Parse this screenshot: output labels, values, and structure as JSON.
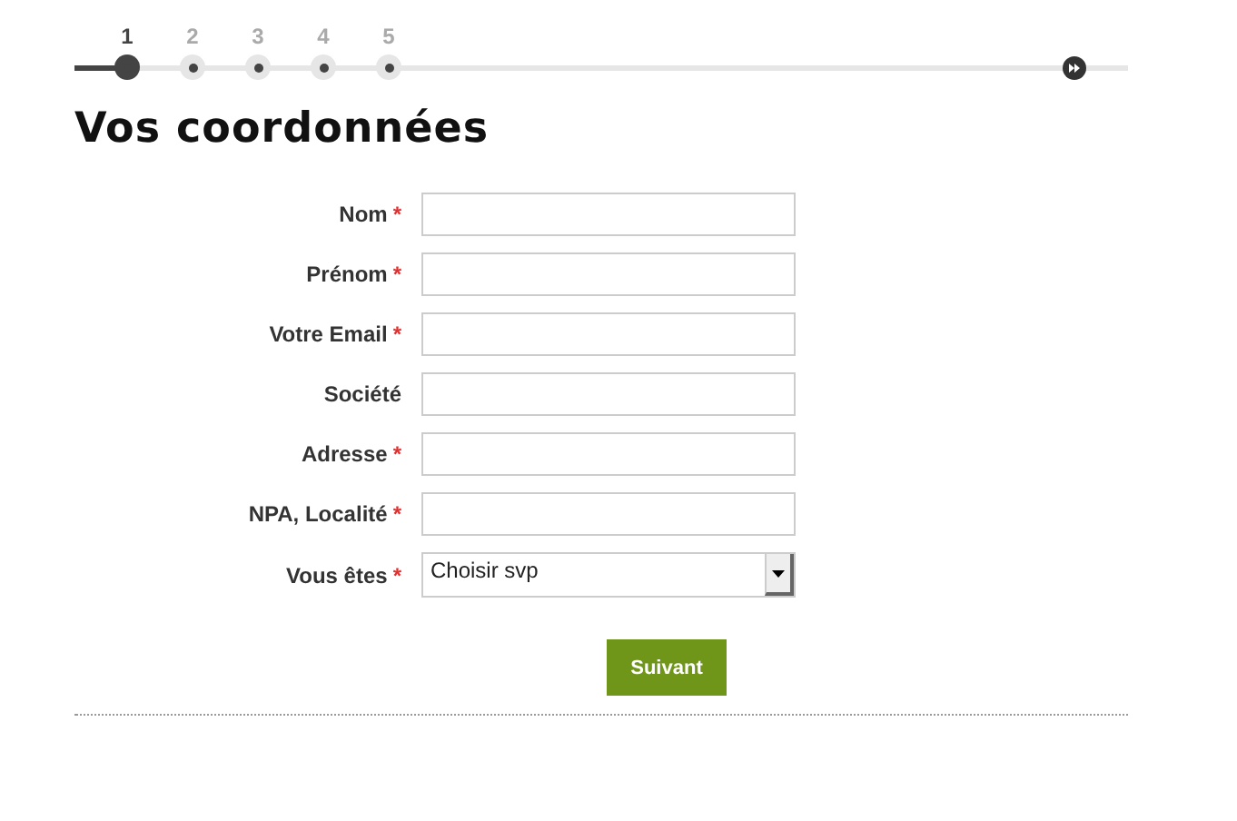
{
  "steps": [
    {
      "label": "1",
      "selected": true
    },
    {
      "label": "2",
      "selected": false
    },
    {
      "label": "3",
      "selected": false
    },
    {
      "label": "4",
      "selected": false
    },
    {
      "label": "5",
      "selected": false
    }
  ],
  "heading": "Vos coordonnées",
  "fields": [
    {
      "kind": "text",
      "label": "Nom",
      "required_mark": "*"
    },
    {
      "kind": "text",
      "label": "Prénom",
      "required_mark": "*"
    },
    {
      "kind": "text",
      "label": "Votre Email",
      "required_mark": "*"
    },
    {
      "kind": "text",
      "label": "Société"
    },
    {
      "kind": "text",
      "label": "Adresse",
      "required_mark": "*"
    },
    {
      "kind": "text",
      "label": "NPA, Localité",
      "required_mark": "*"
    },
    {
      "kind": "select",
      "label": "Vous êtes",
      "required_mark": "*",
      "value": "Choisir svp"
    }
  ],
  "submit": "Suivant"
}
